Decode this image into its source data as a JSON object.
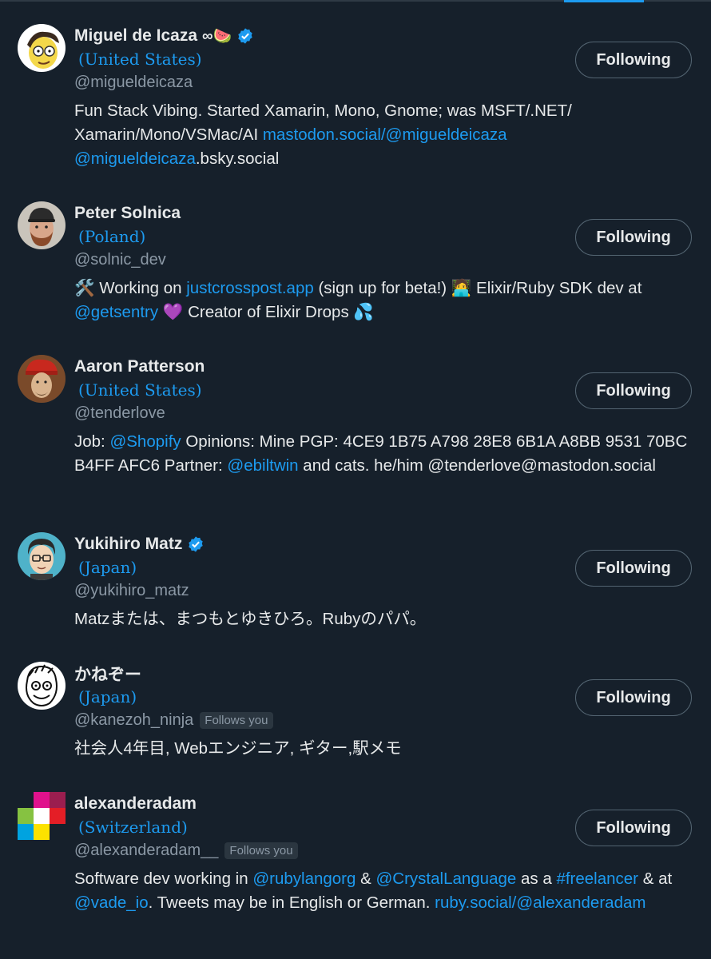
{
  "colors": {
    "background": "#16202b",
    "link": "#1d9bf0",
    "muted": "#8b98a5",
    "verified": "#1d9bf0"
  },
  "accounts": [
    {
      "name": "Miguel de Icaza",
      "name_emoji": "∞🍉",
      "verified": true,
      "location": "(United States)",
      "handle": "@migueldeicaza",
      "follows_you": "",
      "button": "Following",
      "avatar_icon": "cartoon-yellow-face-avatar",
      "bio": {
        "t1": "Fun Stack Vibing. Started Xamarin, Mono, Gnome; was MSFT/.NET/ Xamarin/Mono/VSMac/AI ",
        "l1": "mastodon.social/@migueldeicaza",
        "t2": " ",
        "l2": "@migueldeicaza",
        "t3": ".bsky.social"
      }
    },
    {
      "name": "Peter Solnica",
      "verified": false,
      "location": "(Poland)",
      "handle": "@solnic_dev",
      "follows_you": "",
      "button": "Following",
      "avatar_icon": "bearded-man-cap-avatar",
      "bio": {
        "e1": "🛠️",
        "t1": " Working on ",
        "l1": "justcrosspost.app",
        "t2": " (sign up for beta!) ",
        "e2": "🧑‍💻",
        "t3": " Elixir/Ruby SDK dev at ",
        "l2": "@getsentry",
        "t4": " ",
        "e3": "💜",
        "t5": " Creator of Elixir Drops ",
        "e4": "💦"
      }
    },
    {
      "name": "Aaron Patterson",
      "verified": false,
      "location": "(United States)",
      "handle": "@tenderlove",
      "follows_you": "",
      "button": "Following",
      "avatar_icon": "painting-red-hat-avatar",
      "bio": {
        "t1": "Job: ",
        "l1": "@Shopify",
        "t2": " Opinions: Mine PGP: 4CE9 1B75 A798 28E8 6B1A A8BB 9531 70BC B4FF AFC6 Partner: ",
        "l2": "@ebiltwin",
        "t3": " and cats. he/him @tenderlove@mastodon.social"
      }
    },
    {
      "name": "Yukihiro Matz",
      "verified": true,
      "location": "(Japan)",
      "handle": "@yukihiro_matz",
      "follows_you": "",
      "button": "Following",
      "avatar_icon": "cartoon-glasses-man-avatar",
      "bio": {
        "t1": "Matzまたは、まつもとゆきひろ。Rubyのパパ。"
      }
    },
    {
      "name": "かねぞー",
      "verified": false,
      "location": "(Japan)",
      "handle": "@kanezoh_ninja",
      "follows_you": "Follows you",
      "button": "Following",
      "avatar_icon": "sketch-face-avatar",
      "bio": {
        "t1": "社会人4年目, Webエンジニア, ギター,駅メモ"
      }
    },
    {
      "name": "alexanderadam",
      "verified": false,
      "location": "(Switzerland)",
      "handle": "@alexanderadam__",
      "follows_you": "Follows you",
      "button": "Following",
      "avatar_icon": "colorful-tiles-avatar",
      "bio": {
        "t1": "Software dev working in ",
        "l1": "@rubylangorg",
        "t2": " & ",
        "l2": "@CrystalLanguage",
        "t3": " as a ",
        "l3": "#freelancer",
        "t4": " & at ",
        "l4": "@vade_io",
        "t5": ". Tweets may be in English or German. ",
        "l5": "ruby.social/@alexanderadam"
      }
    }
  ]
}
